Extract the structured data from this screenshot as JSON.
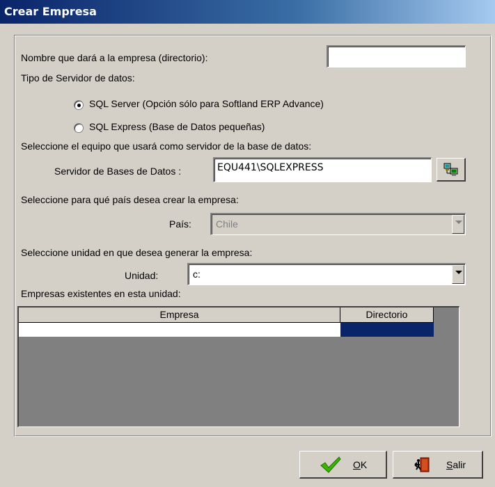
{
  "window": {
    "title": "Crear Empresa"
  },
  "form": {
    "company_name_label": "Nombre que dará a la empresa (directorio):",
    "company_name_value": "",
    "server_type_label": "Tipo de Servidor de datos:",
    "radio_sqlserver_label": "SQL Server (Opción sólo para Softland ERP Advance)",
    "radio_sqlexpress_label": "SQL Express (Base de Datos pequeñas)",
    "selected_server_type": "SQL Server",
    "select_server_label": "Seleccione el equipo que usará como servidor de la base de datos:",
    "db_server_label": "Servidor de Bases de Datos :",
    "db_server_value": "EQU441\\SQLEXPRESS",
    "country_prompt": "Seleccione para qué país desea crear la empresa:",
    "country_label": "País:",
    "country_value": "Chile",
    "unit_prompt": "Seleccione unidad en que desea generar la empresa:",
    "unit_label": "Unidad:",
    "unit_value": "c:",
    "existing_label": "Empresas existentes en esta unidad:"
  },
  "grid": {
    "columns": [
      "Empresa",
      "Directorio"
    ],
    "rows": [
      [
        "",
        ""
      ]
    ]
  },
  "buttons": {
    "ok_label": "OK",
    "ok_accel": "O",
    "exit_label": "Salir",
    "exit_accel": "S"
  },
  "colors": {
    "title_start": "#0a246a",
    "title_end": "#a6caf0",
    "face": "#d4d0c8",
    "selection": "#0a246a"
  }
}
